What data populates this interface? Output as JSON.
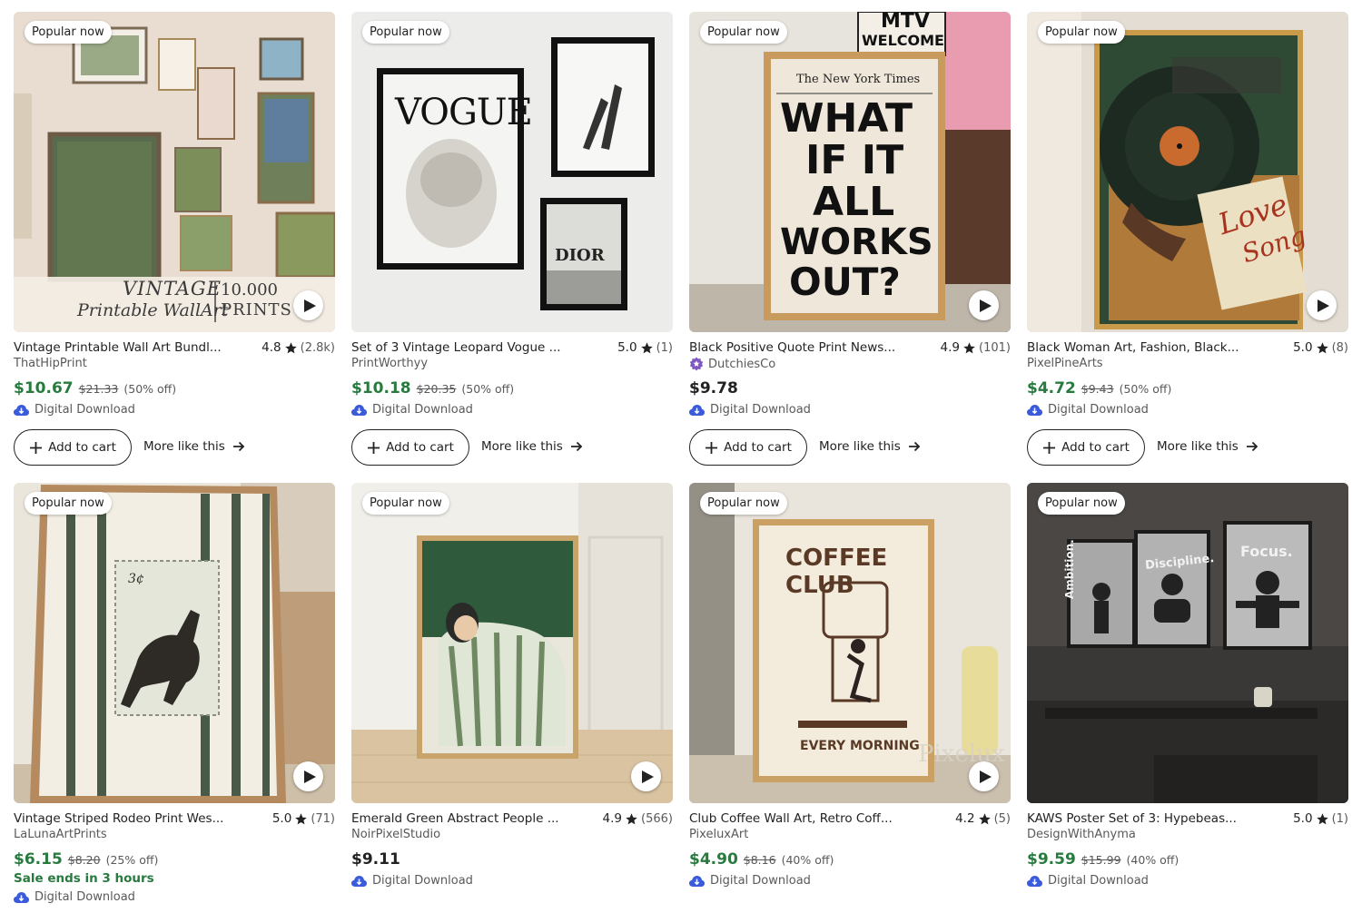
{
  "colors": {
    "sale_price": "#287a3f",
    "star": "#222222",
    "digital_icon": "#3b5bdb",
    "star_seller": "#7e57c2"
  },
  "badge_label": "Popular now",
  "add_to_cart_label": "Add to cart",
  "more_like_label": "More like this",
  "digital_label": "Digital Download",
  "products": [
    {
      "title": "Vintage Printable Wall Art Bundl...",
      "rating": "4.8",
      "reviews": "(2.8k)",
      "shop": "ThatHipPrint",
      "price": "$10.67",
      "original_price": "$21.33",
      "discount": "(50% off)",
      "overlay_line1": "VINTAGE",
      "overlay_line2": "Printable WallArt",
      "overlay_line3": "10.000",
      "overlay_line4": "PRINTS"
    },
    {
      "title": "Set of 3 Vintage Leopard Vogue ...",
      "rating": "5.0",
      "reviews": "(1)",
      "shop": "PrintWorthyy",
      "price": "$10.18",
      "original_price": "$20.35",
      "discount": "(50% off)",
      "overlay_line1": "VOGUE",
      "overlay_line2": "DIOR"
    },
    {
      "title": "Black Positive Quote Print News...",
      "rating": "4.9",
      "reviews": "(101)",
      "shop": "DutchiesCo",
      "price": "$9.78",
      "overlay_line1": "MTV",
      "overlay_line2": "WELCOME",
      "overlay_line3": "The New York Times",
      "overlay_line4": "WHAT",
      "overlay_line5": "IF IT",
      "overlay_line6": "ALL",
      "overlay_line7": "WORKS",
      "overlay_line8": "OUT?"
    },
    {
      "title": "Black Woman Art, Fashion, Black...",
      "rating": "5.0",
      "reviews": "(8)",
      "shop": "PixelPineArts",
      "price": "$4.72",
      "original_price": "$9.43",
      "discount": "(50% off)",
      "overlay_line1": "Love",
      "overlay_line2": "Song"
    },
    {
      "title": "Vintage Striped Rodeo Print Wes...",
      "rating": "5.0",
      "reviews": "(71)",
      "shop": "LaLunaArtPrints",
      "price": "$6.15",
      "original_price": "$8.20",
      "discount": "(25% off)",
      "sale_ends": "Sale ends in 3 hours",
      "overlay_line1": "3¢"
    },
    {
      "title": "Emerald Green Abstract People ...",
      "rating": "4.9",
      "reviews": "(566)",
      "shop": "NoirPixelStudio",
      "price": "$9.11"
    },
    {
      "title": "Club Coffee Wall Art, Retro Coff...",
      "rating": "4.2",
      "reviews": "(5)",
      "shop": "PixeluxArt",
      "price": "$4.90",
      "original_price": "$8.16",
      "discount": "(40% off)",
      "overlay_line1": "COFFEE",
      "overlay_line2": "CLUB",
      "overlay_line3": "EVERY MORNING",
      "overlay_line4": "Pixelux"
    },
    {
      "title": "KAWS Poster Set of 3: Hypebeas...",
      "rating": "5.0",
      "reviews": "(1)",
      "shop": "DesignWithAnyma",
      "price": "$9.59",
      "original_price": "$15.99",
      "discount": "(40% off)",
      "overlay_line1": "Ambition.",
      "overlay_line2": "Discipline.",
      "overlay_line3": "Focus."
    }
  ]
}
